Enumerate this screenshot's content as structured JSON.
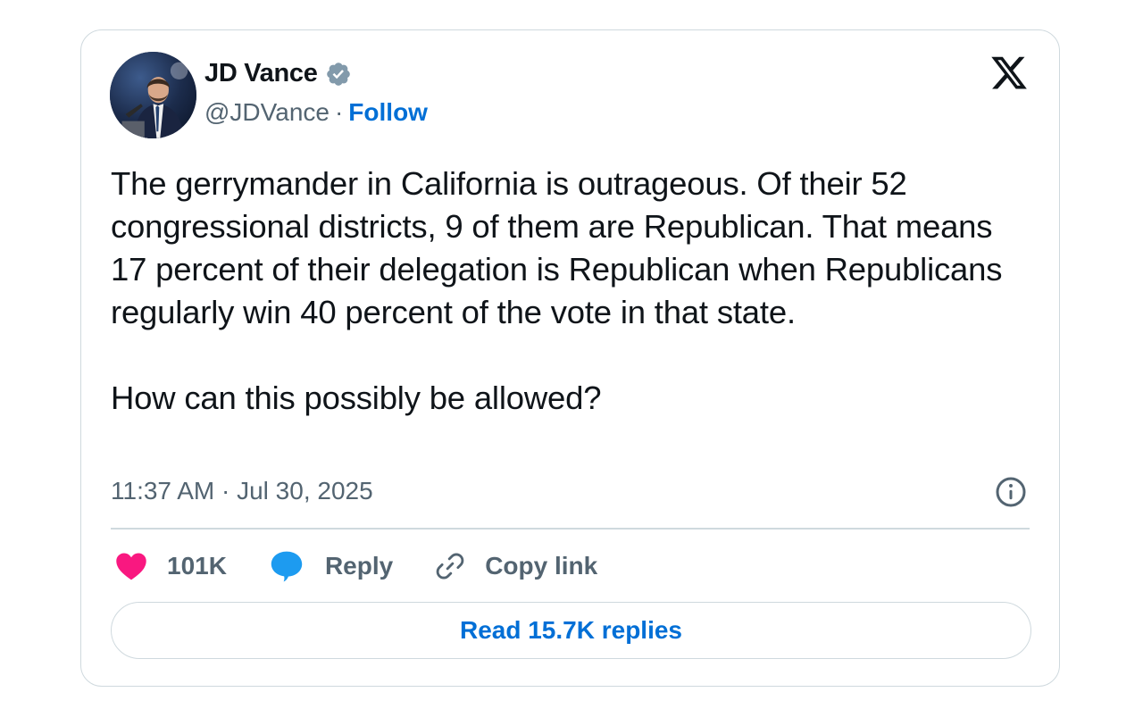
{
  "author": {
    "name": "JD Vance",
    "handle": "@JDVance",
    "separator": "·",
    "follow_label": "Follow",
    "verified": true
  },
  "brand": {
    "logo": "x-logo-icon"
  },
  "tweet": {
    "paragraphs": [
      "The gerrymander in California is outrageous. Of their 52 congressional districts, 9 of them are Republican. That means 17 percent of their delegation is Republican when Republicans regularly win 40 percent of the vote in that state.",
      "How can this possibly be allowed?"
    ],
    "timestamp": "11:37 AM · Jul 30, 2025"
  },
  "actions": {
    "like_count": "101K",
    "reply_label": "Reply",
    "copy_link_label": "Copy link"
  },
  "read_replies_label": "Read 15.7K replies",
  "colors": {
    "link_blue": "#006fd6",
    "like_pink": "#f91880",
    "reply_blue": "#1d9bf0",
    "verified_gray": "#829aab",
    "muted_text": "#536471",
    "border": "#cfd9de"
  }
}
